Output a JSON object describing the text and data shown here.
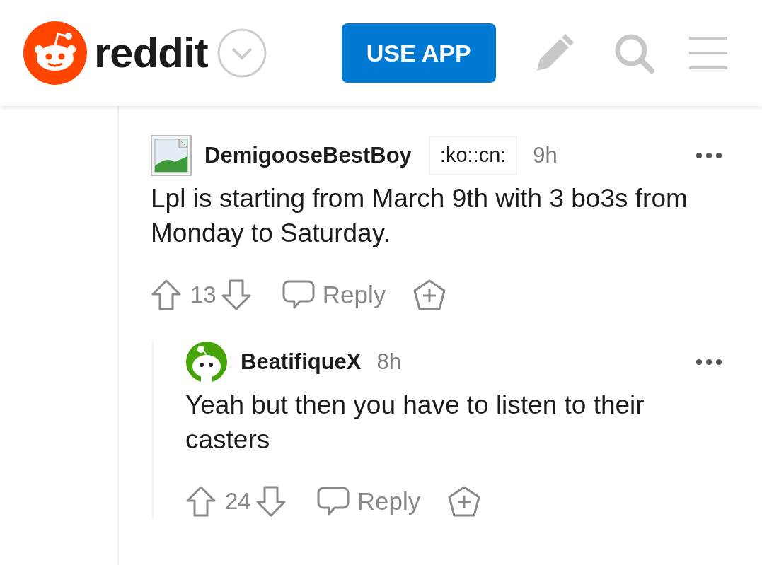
{
  "header": {
    "logo_text": "reddit",
    "use_app_button": "USE APP"
  },
  "comments": [
    {
      "avatar": {
        "kind": "broken-image"
      },
      "author": "DemigooseBestBoy",
      "flair": ":ko::cn:",
      "time": "9h",
      "body": "Lpl is starting from March 9th with 3 bo3s from Monday to Saturday.",
      "score": "13",
      "reply_label": "Reply",
      "replies": [
        {
          "avatar": {
            "kind": "snoo"
          },
          "author": "BeatifiqueX",
          "time": "8h",
          "body": "Yeah but then you have to listen to their casters",
          "score": "24",
          "reply_label": "Reply"
        }
      ]
    }
  ]
}
